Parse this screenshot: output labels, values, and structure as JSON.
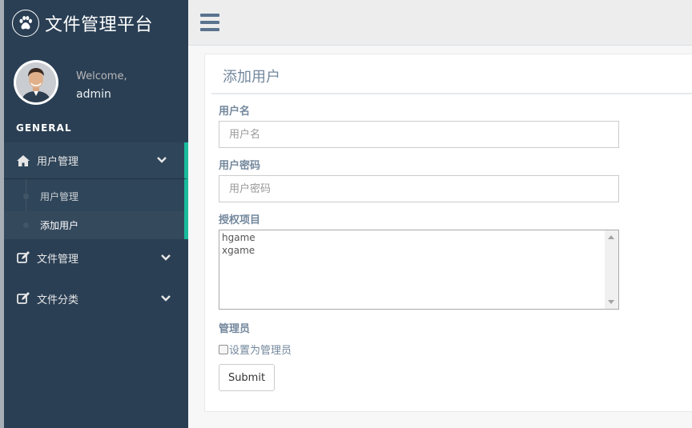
{
  "app": {
    "title": "文件管理平台",
    "logo_icon": "paw-icon"
  },
  "profile": {
    "welcome": "Welcome,",
    "username": "admin"
  },
  "sidebar": {
    "section_title": "GENERAL",
    "menus": [
      {
        "label": "用户管理",
        "icon": "home-icon",
        "expanded": true,
        "children": [
          {
            "label": "用户管理"
          },
          {
            "label": "添加用户",
            "current": true
          }
        ]
      },
      {
        "label": "文件管理",
        "icon": "edit-icon"
      },
      {
        "label": "文件分类",
        "icon": "edit-icon"
      }
    ]
  },
  "form": {
    "title": "添加用户",
    "username": {
      "label": "用户名",
      "placeholder": "用户名",
      "value": ""
    },
    "password": {
      "label": "用户密码",
      "placeholder": "用户密码",
      "value": ""
    },
    "projects": {
      "label": "授权项目",
      "options": [
        "hgame",
        "xgame"
      ]
    },
    "admin": {
      "label": "管理员",
      "checkbox_label": "设置为管理员",
      "checked": false
    },
    "submit_label": "Submit"
  },
  "colors": {
    "sidebar_bg": "#2a3f54",
    "accent": "#1abb9c",
    "text": "#73879c",
    "topbar_bg": "#ededed"
  }
}
